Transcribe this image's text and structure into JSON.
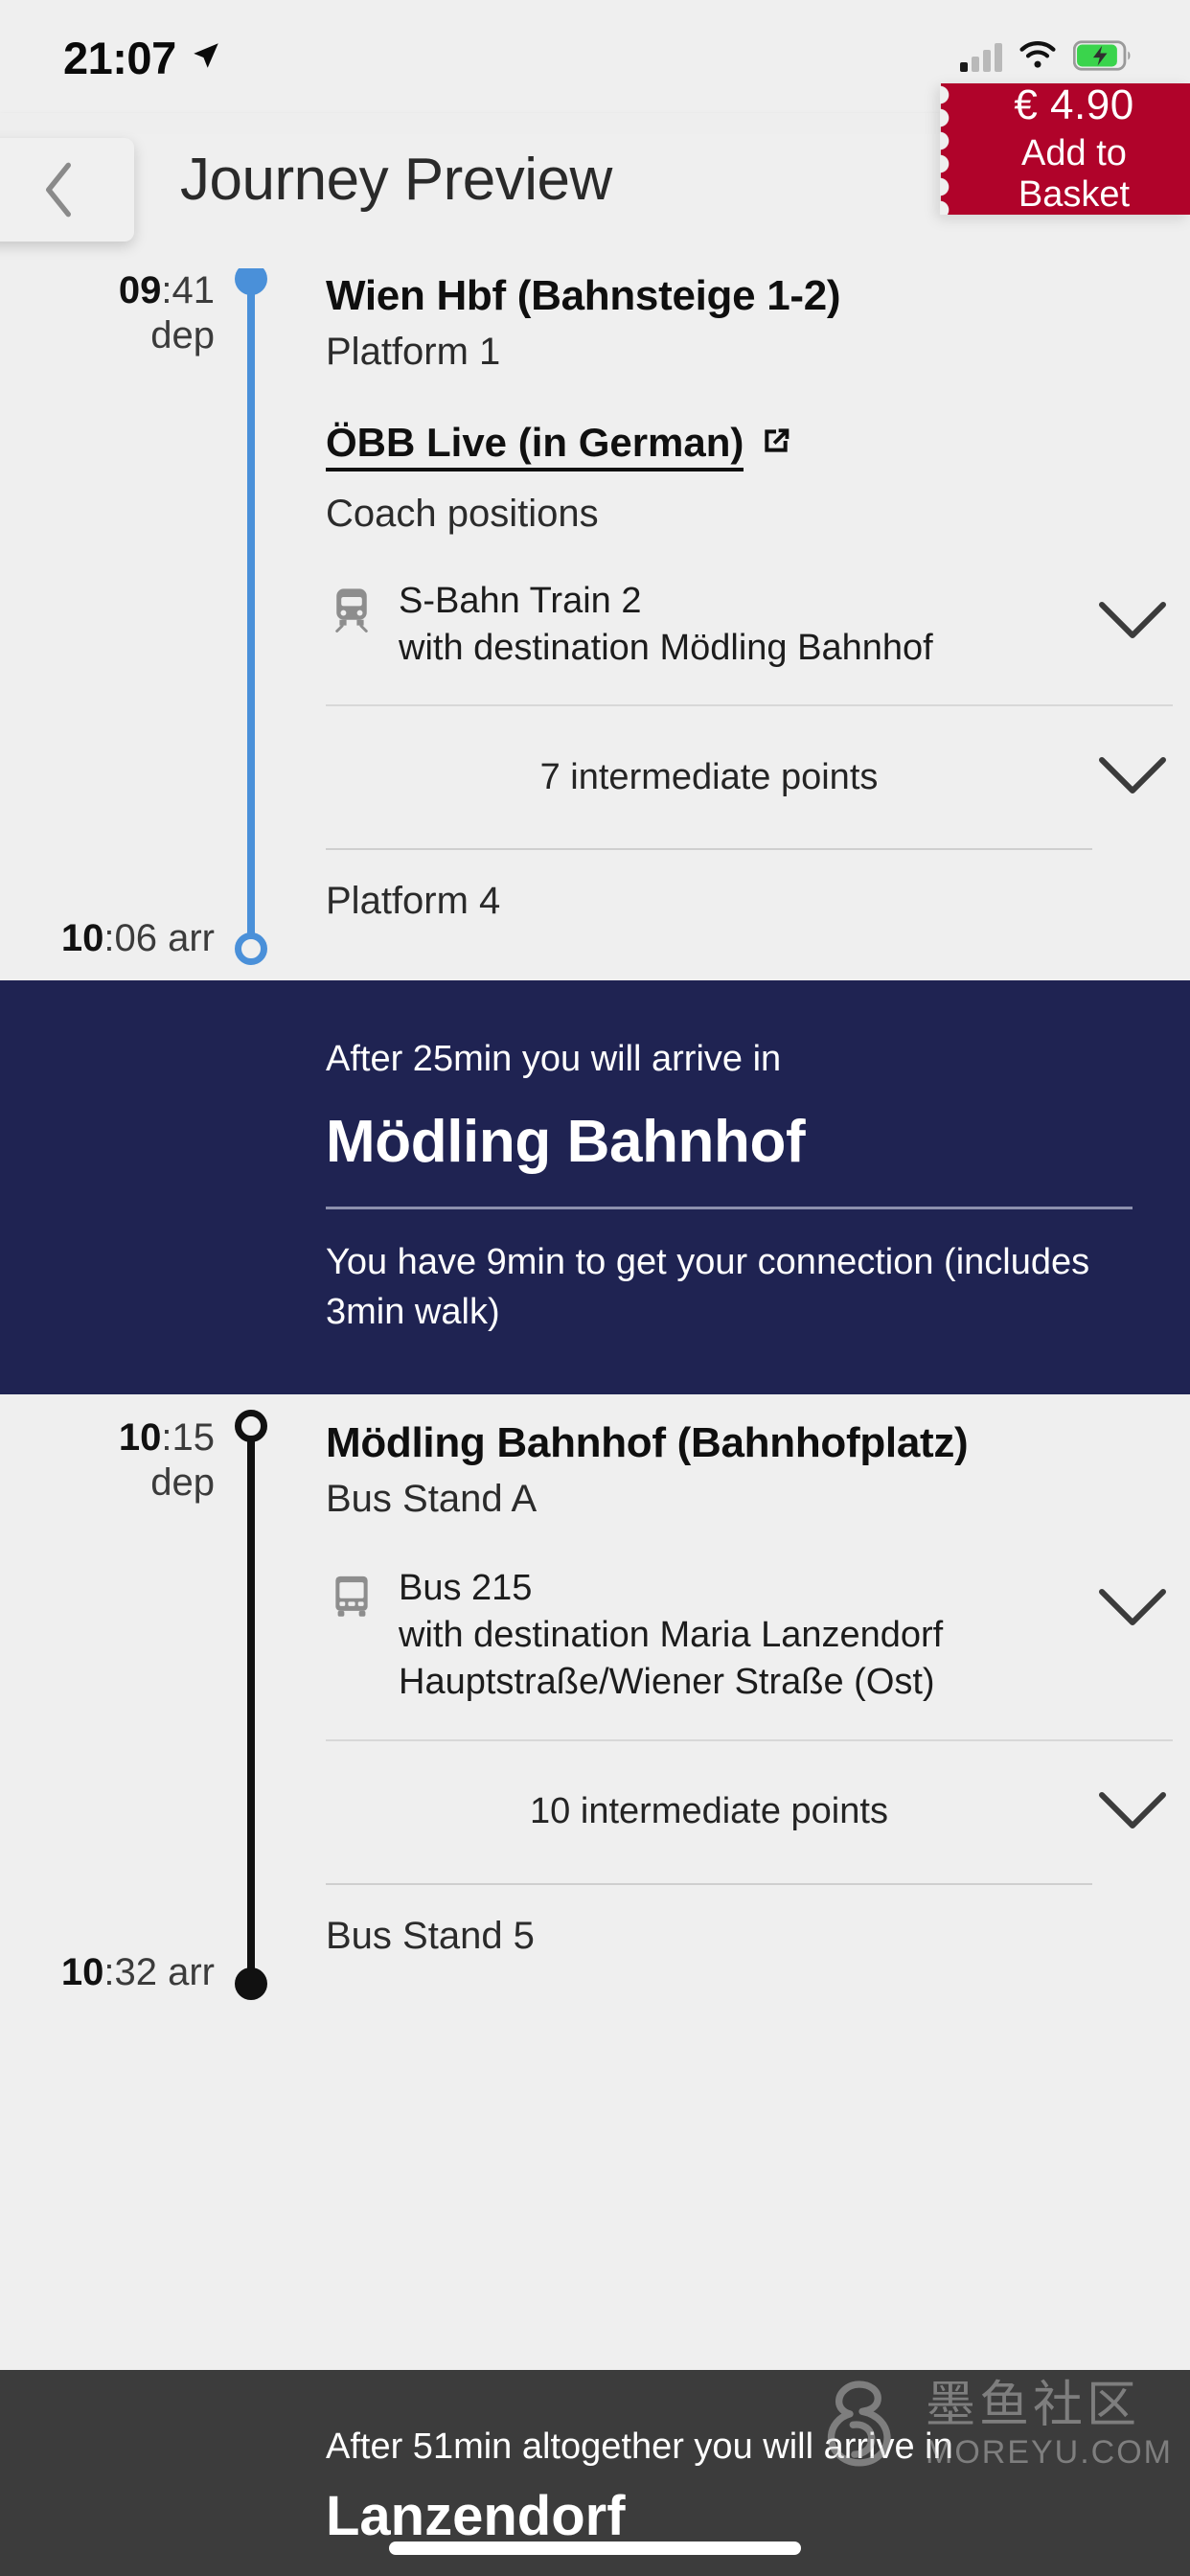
{
  "status_bar": {
    "time": "21:07",
    "location_icon": "location-arrow-icon",
    "signal_icon": "cellular-signal-icon",
    "wifi_icon": "wifi-icon",
    "battery_icon": "battery-charging-icon"
  },
  "header": {
    "back_icon": "chevron-left-icon",
    "title": "Journey Preview",
    "ticket": {
      "price": "€ 4.90",
      "action_line1": "Add to",
      "action_line2": "Basket",
      "color": "#b0032a"
    }
  },
  "legs": [
    {
      "accent_color": "#4a90d9",
      "depart_hh": "09",
      "depart_mm": ":41",
      "depart_tag": "dep",
      "arrive_hh": "10",
      "arrive_mm": ":06 arr",
      "origin": "Wien Hbf (Bahnsteige 1-2)",
      "origin_platform": "Platform 1",
      "live_link": "ÖBB Live (in German)",
      "live_link_icon": "external-link-icon",
      "coach_positions": "Coach positions",
      "service_icon": "train-icon",
      "service_name": "S-Bahn Train 2",
      "service_destination": "with destination Mödling Bahnhof",
      "service_chevron": "chevron-down-icon",
      "intermediate": "7 intermediate points",
      "intermediate_chevron": "chevron-down-icon",
      "arrive_platform": "Platform 4"
    },
    {
      "accent_color": "#111111",
      "depart_hh": "10",
      "depart_mm": ":15",
      "depart_tag": "dep",
      "arrive_hh": "10",
      "arrive_mm": ":32 arr",
      "origin": "Mödling Bahnhof (Bahnhofplatz)",
      "origin_platform": "Bus Stand A",
      "service_icon": "bus-icon",
      "service_name": "Bus 215",
      "service_destination": "with destination Maria Lanzendorf Hauptstraße/Wiener Straße (Ost)",
      "service_chevron": "chevron-down-icon",
      "intermediate": "10 intermediate points",
      "intermediate_chevron": "chevron-down-icon",
      "arrive_platform": "Bus Stand 5"
    }
  ],
  "connection_panel": {
    "lead": "After 25min you will arrive in",
    "destination": "Mödling Bahnhof",
    "note": "You have 9min to get your connection (includes 3min walk)",
    "background": "#1f2352"
  },
  "footer": {
    "lead": "After 51min altogether you will arrive in",
    "destination": "Lanzendorf",
    "background": "#3c3c3c"
  },
  "watermark": {
    "cn": "墨鱼社区",
    "en": "MOREYU.COM",
    "icon": "moreyu-logo-icon"
  }
}
